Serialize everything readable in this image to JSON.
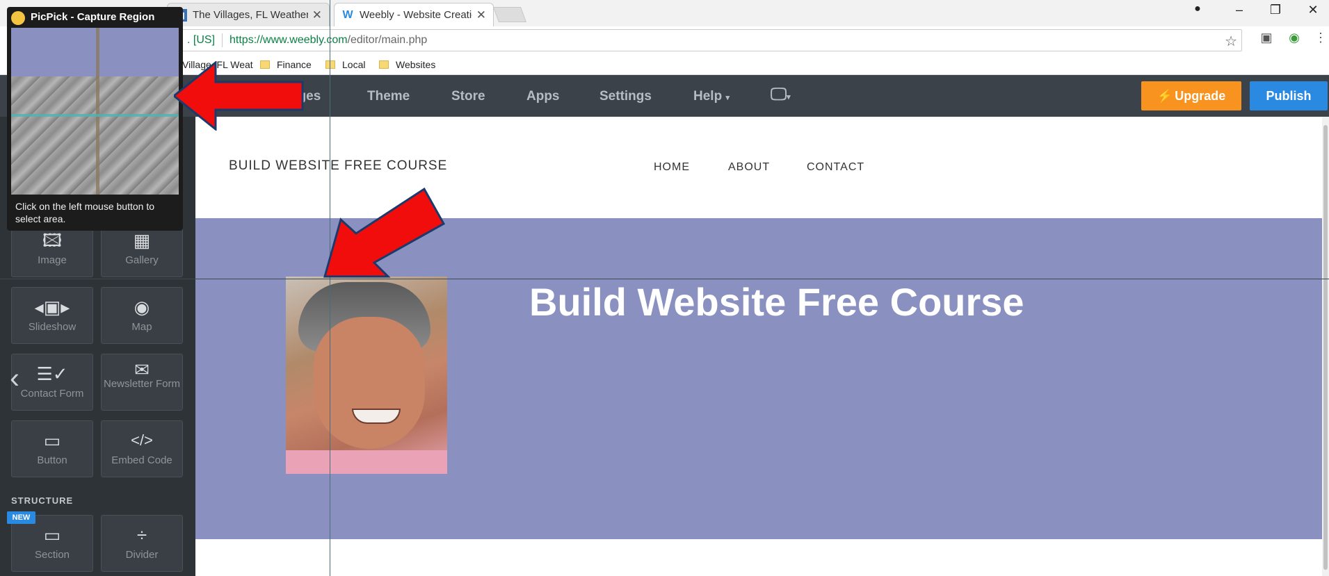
{
  "browser": {
    "tabs": [
      {
        "title": "The Villages, FL Weather",
        "favicon": "weather-favicon"
      },
      {
        "title": "Weebly - Website Creatio",
        "favicon": "weebly-favicon"
      }
    ],
    "address": {
      "security": ". [US]",
      "url_host": "https://www.weebly.com",
      "url_path": "/editor/main.php"
    },
    "bookmarks": [
      {
        "label": "Village, FL Weat"
      },
      {
        "label": "Finance"
      },
      {
        "label": "Local"
      },
      {
        "label": "Websites"
      }
    ]
  },
  "editor": {
    "nav": [
      "ages",
      "Theme",
      "Store",
      "Apps",
      "Settings",
      "Help"
    ],
    "upgrade_label": "Upgrade",
    "publish_label": "Publish"
  },
  "sidebar": {
    "tiles": [
      {
        "label": "Image",
        "icon": "image-icon"
      },
      {
        "label": "Gallery",
        "icon": "gallery-icon"
      },
      {
        "label": "Slideshow",
        "icon": "slideshow-icon"
      },
      {
        "label": "Map",
        "icon": "map-icon"
      },
      {
        "label": "Contact Form",
        "icon": "contact-form-icon"
      },
      {
        "label": "Newsletter Form",
        "icon": "envelope-icon"
      },
      {
        "label": "Button",
        "icon": "button-icon"
      },
      {
        "label": "Embed Code",
        "icon": "code-icon"
      },
      {
        "label": "Section",
        "icon": "section-icon"
      },
      {
        "label": "Divider",
        "icon": "divider-icon"
      }
    ],
    "structure_heading": "STRUCTURE",
    "new_badge": "NEW"
  },
  "site": {
    "title": "BUILD WEBSITE FREE COURSE",
    "nav": [
      "HOME",
      "ABOUT",
      "CONTACT"
    ],
    "headline": "Build Website Free Course"
  },
  "picpick": {
    "title": "PicPick - Capture Region",
    "instruction": "Click on the left mouse button to select area."
  },
  "colors": {
    "banner": "#8a91c1",
    "upgrade": "#f7931e",
    "publish": "#2a8ae2",
    "arrow": "#f20d0d"
  }
}
